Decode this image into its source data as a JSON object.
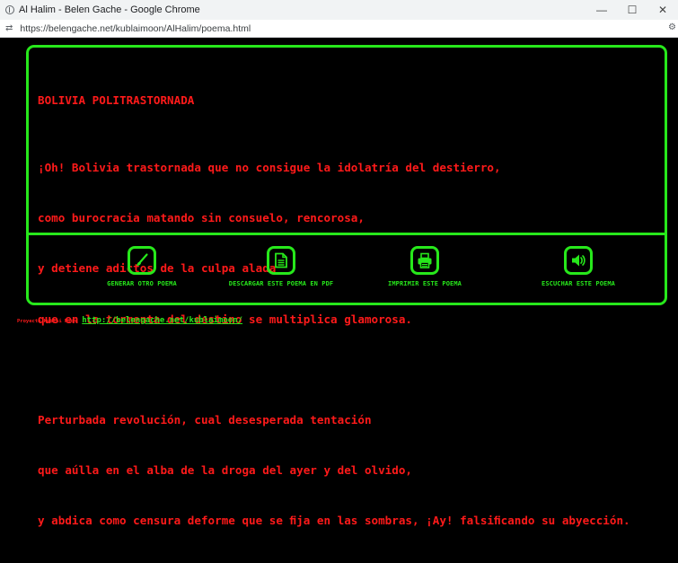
{
  "browser": {
    "tab_title": "Al Halim - Belen Gache - Google Chrome",
    "url": "https://belengache.net/kublaimoon/AlHalim/poema.html",
    "minimize_glyph": "—",
    "maximize_glyph": "☐",
    "close_glyph": "✕",
    "menu_glyph": "⚙"
  },
  "poem": {
    "title": "BOLIVIA POLITRASTORNADA",
    "stanza1": [
      "¡Oh! Bolivia trastornada que no consigue la idolatría del destierro,",
      "como burocracia matando sin consuelo, rencorosa,",
      "y detiene adictos de la culpa alada",
      "que en la tormenta del destino se multiplica glamorosa."
    ],
    "stanza2": [
      "Perturbada revolución, cual desesperada tentación",
      "que aúlla en el alba de la droga del ayer y del olvido,",
      "y abdica como censura deforme que se ﬁja en las sombras, ¡Ay! falsiﬁcando su abyección."
    ]
  },
  "actions": [
    {
      "label": "GENERAR OTRO POEMA",
      "icon": "brush-icon"
    },
    {
      "label": "DESCARGAR ESTE POEMA EN PDF",
      "icon": "document-icon"
    },
    {
      "label": "IMPRIMIR ESTE POEMA",
      "icon": "printer-icon"
    },
    {
      "label": "ESCUCHAR ESTE POEMA",
      "icon": "speaker-icon"
    }
  ],
  "footer": {
    "project_label": "Proyecto Kublai Moon",
    "link_text": "http://belengache.net/kublaimoon/"
  },
  "colors": {
    "accent_green": "#27e81b",
    "poem_red": "#ff1a1a",
    "background": "#000000"
  }
}
